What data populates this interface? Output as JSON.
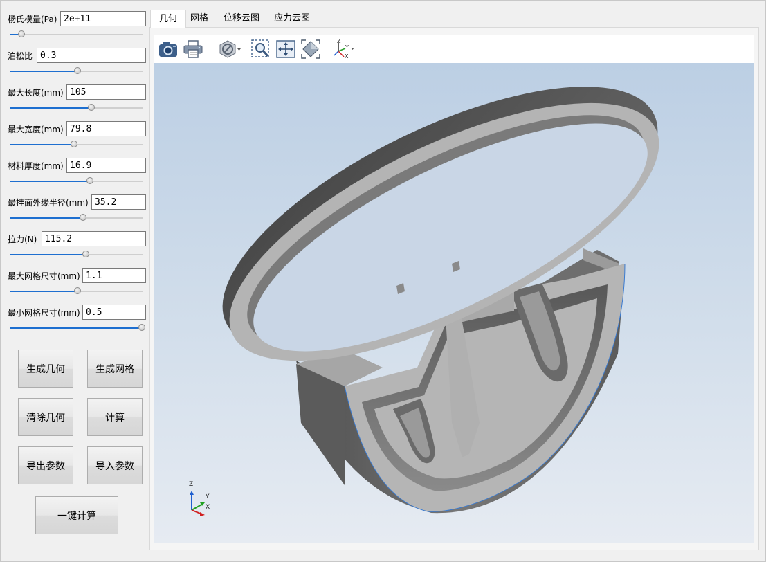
{
  "params": [
    {
      "label": "杨氏模量(Pa)",
      "value": "2e+11",
      "slider": 0.09
    },
    {
      "label": "泊松比",
      "value": "0.3",
      "slider": 0.51
    },
    {
      "label": "最大长度(mm)",
      "value": "105",
      "slider": 0.61
    },
    {
      "label": "最大宽度(mm)",
      "value": "79.8",
      "slider": 0.48
    },
    {
      "label": "材料厚度(mm)",
      "value": "16.9",
      "slider": 0.6
    },
    {
      "label": "最挂面外缘半径(mm)",
      "value": "35.2",
      "slider": 0.55
    },
    {
      "label": "拉力(N)",
      "value": "115.2",
      "slider": 0.57
    },
    {
      "label": "最大网格尺寸(mm)",
      "value": "1.1",
      "slider": 0.51
    },
    {
      "label": "最小网格尺寸(mm)",
      "value": "0.5",
      "slider": 0.99
    }
  ],
  "buttons": {
    "gen_geometry": "生成几何",
    "gen_mesh": "生成网格",
    "clear_geometry": "清除几何",
    "compute": "计算",
    "export_params": "导出参数",
    "import_params": "导入参数",
    "one_click": "一键计算"
  },
  "tabs": [
    "几何",
    "网格",
    "位移云图",
    "应力云图"
  ],
  "active_tab": 0,
  "toolbar": [
    "camera-icon",
    "print-icon",
    "display-mode-icon",
    "zoom-window-icon",
    "pan-icon",
    "fit-all-icon",
    "axes-view-icon"
  ],
  "axes": {
    "x": "X",
    "y": "Y",
    "z": "Z"
  },
  "colors": {
    "accent": "#1e6fd0",
    "viewport_top": "#bccfe4",
    "viewport_bottom": "#e6ebf2",
    "model_face": "#b4b4b4",
    "model_side": "#626262"
  }
}
